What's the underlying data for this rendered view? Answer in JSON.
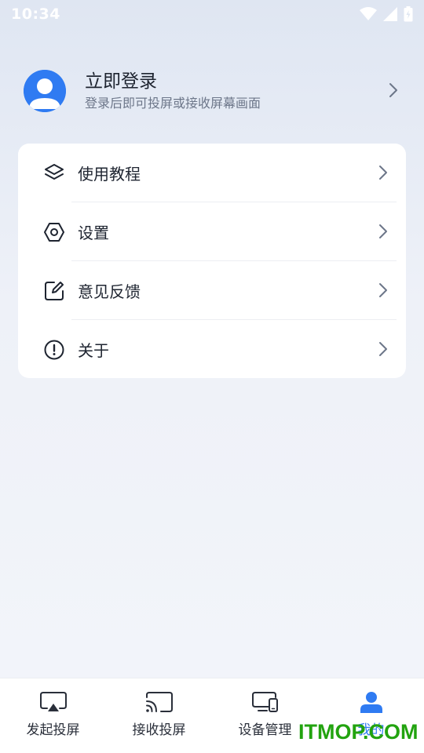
{
  "status_bar": {
    "time": "10:34",
    "icons": [
      "wifi-icon",
      "signal-icon",
      "battery-icon"
    ]
  },
  "profile": {
    "title": "立即登录",
    "subtitle": "登录后即可投屏或接收屏幕画面"
  },
  "menu": {
    "items": [
      {
        "label": "使用教程",
        "icon": "layers-icon"
      },
      {
        "label": "设置",
        "icon": "hexagon-settings-icon"
      },
      {
        "label": "意见反馈",
        "icon": "edit-note-icon"
      },
      {
        "label": "关于",
        "icon": "info-alert-icon"
      }
    ]
  },
  "bottom_nav": {
    "items": [
      {
        "label": "发起投屏",
        "icon": "airplay-icon"
      },
      {
        "label": "接收投屏",
        "icon": "cast-icon"
      },
      {
        "label": "设备管理",
        "icon": "devices-icon"
      },
      {
        "label": "我的",
        "icon": "person-icon",
        "active": true
      }
    ]
  },
  "watermark": {
    "text": "ITMOP.COM"
  },
  "colors": {
    "accent": "#2f7bf2",
    "watermark": "#22a30f",
    "text_primary": "#1e2430",
    "text_secondary": "#6c7689"
  }
}
